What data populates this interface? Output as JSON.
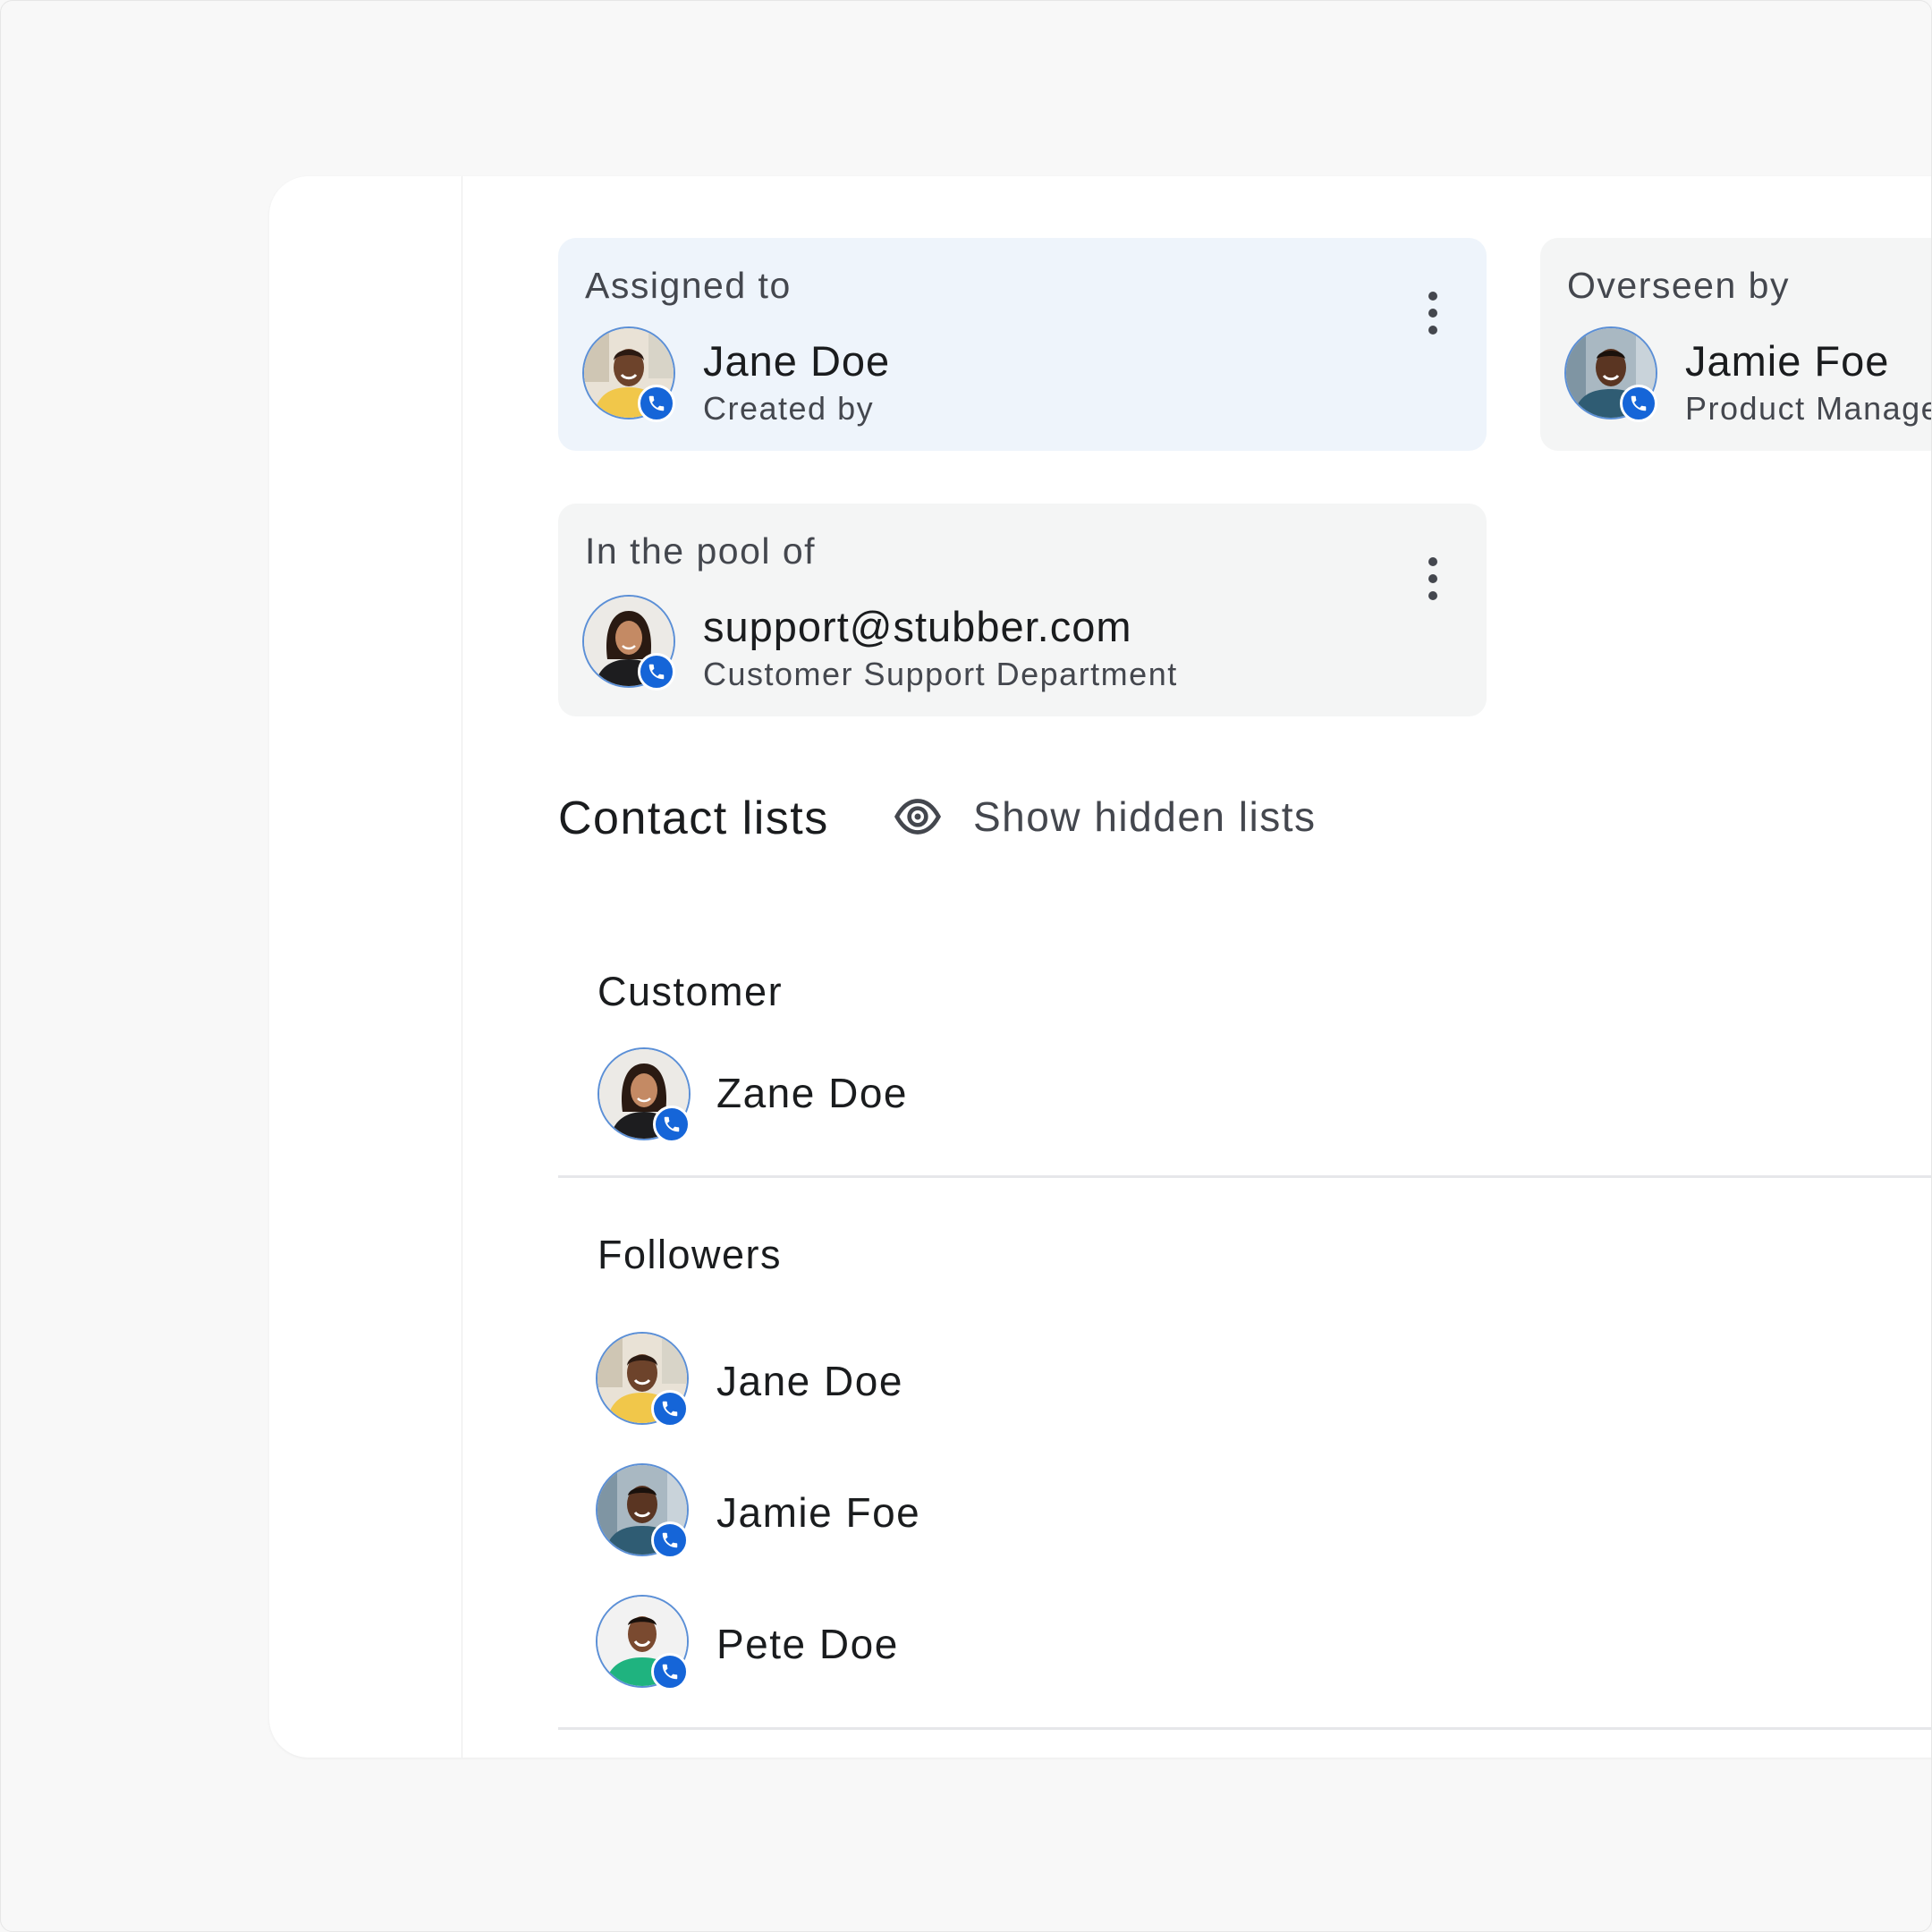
{
  "assignment": {
    "assigned_to": {
      "label": "Assigned to",
      "name": "Jane Doe",
      "subtitle": "Created by"
    },
    "overseen_by": {
      "label": "Overseen by",
      "name": "Jamie Foe",
      "subtitle": "Product Manage"
    },
    "pool": {
      "label": "In the pool of",
      "name": "support@stubber.com",
      "subtitle": "Customer Support Department"
    }
  },
  "contact_lists": {
    "title": "Contact lists",
    "show_hidden_label": "Show hidden lists",
    "lists": [
      {
        "heading": "Customer",
        "contacts": [
          {
            "name": "Zane Doe"
          }
        ]
      },
      {
        "heading": "Followers",
        "contacts": [
          {
            "name": "Jane Doe"
          },
          {
            "name": "Jamie Foe"
          },
          {
            "name": "Pete Doe"
          }
        ]
      }
    ]
  },
  "icons": {
    "more": "more-vert-icon",
    "eye": "eye-icon",
    "call": "phone-icon"
  },
  "colors": {
    "accent": "#1565d8",
    "assigned_card_bg": "#eef4fb",
    "card_bg": "#f4f5f5",
    "panel_bg": "#ffffff",
    "page_bg": "#f8f8f8"
  }
}
